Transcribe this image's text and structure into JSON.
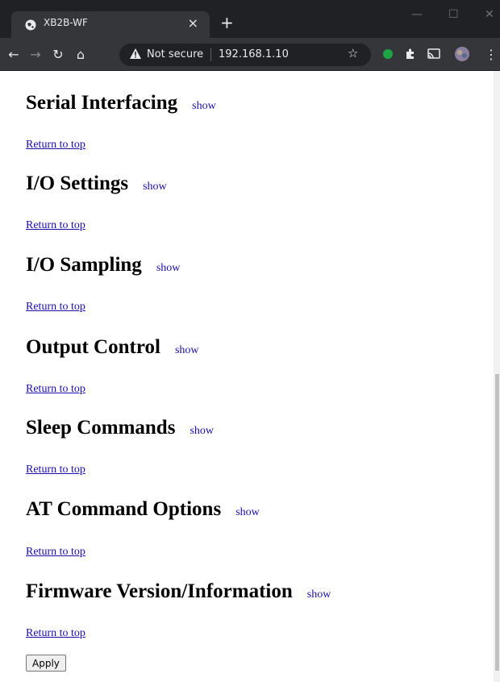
{
  "browser": {
    "tab_title": "XB2B-WF",
    "tab_close": "×",
    "new_tab": "+",
    "window_controls": {
      "minimize": "—",
      "maximize": "☐",
      "close": "✕"
    },
    "security_label": "Not secure",
    "url": "192.168.1.10",
    "icons": [
      "back-icon",
      "forward-icon",
      "reload-icon",
      "home-icon",
      "warning-icon",
      "star-icon",
      "extension-icon",
      "puzzle-icon",
      "cast-icon",
      "profile-avatar",
      "menu-icon"
    ]
  },
  "page": {
    "sections": [
      {
        "title": "Serial Interfacing",
        "show": "show"
      },
      {
        "title": "I/O Settings",
        "show": "show"
      },
      {
        "title": "I/O Sampling",
        "show": "show"
      },
      {
        "title": "Output Control",
        "show": "show"
      },
      {
        "title": "Sleep Commands",
        "show": "show"
      },
      {
        "title": "AT Command Options",
        "show": "show"
      },
      {
        "title": "Firmware Version/Information",
        "show": "show"
      }
    ],
    "return_to_top": "Return to top",
    "apply_label": "Apply"
  },
  "colors": {
    "link": "#1a0dab",
    "chrome_dark": "#202124",
    "chrome_toolbar": "#35363a",
    "extension_green": "#1ea446"
  }
}
